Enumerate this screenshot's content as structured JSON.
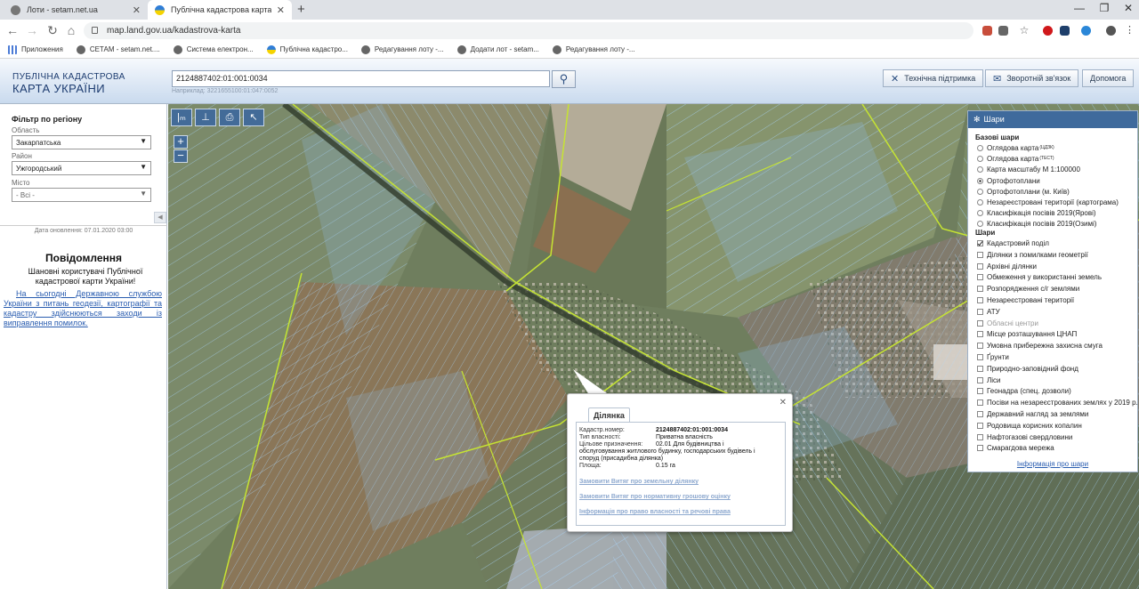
{
  "browser": {
    "tabs": [
      {
        "title": "Лоти - setam.net.ua",
        "icon": "globe-icon"
      },
      {
        "title": "Публічна кадастрова карта Укр",
        "icon": "ua-flag-icon"
      }
    ],
    "url": "map.land.gov.ua/kadastrova-karta",
    "bookmarks": [
      {
        "label": "Приложения",
        "icon": "apps-grid-icon"
      },
      {
        "label": "СЕТАМ - setam.net....",
        "icon": "globe-icon"
      },
      {
        "label": "Система електрон...",
        "icon": "globe-icon"
      },
      {
        "label": "Публічна кадастро...",
        "icon": "ua-flag-icon"
      },
      {
        "label": "Редагування лоту -...",
        "icon": "globe-icon"
      },
      {
        "label": "Додати лот - setam...",
        "icon": "globe-icon"
      },
      {
        "label": "Редагування лоту -...",
        "icon": "globe-icon"
      }
    ]
  },
  "header": {
    "logo_line1": "ПУБЛІЧНА КАДАСТРОВА",
    "logo_line2": "КАРТА УКРАЇНИ",
    "search_value": "2124887402:01:001:0034",
    "search_example": "Наприклад: 3221655100:01:047:0052",
    "buttons": {
      "support": "Технічна підтримка",
      "feedback": "Зворотній зв'язок",
      "help": "Допомога"
    }
  },
  "filter": {
    "title": "Фільтр по регіону",
    "oblast_label": "Область",
    "oblast_value": "Закарпатська",
    "raion_label": "Район",
    "raion_value": "Ужгородський",
    "city_label": "Місто",
    "city_value": "- Всі -"
  },
  "update_date": "Дата оновлення: 07.01.2020 03:00",
  "message": {
    "title": "Повідомлення",
    "greeting": "Шановні користувачі Публічної кадастрової карти України!",
    "body": "На сьогодні Державною службою України з питань геодезії, картографії та кадастру здійснюються заходи із виправлення помилок."
  },
  "popup": {
    "tab_label": "Ділянка",
    "rows": [
      {
        "label": "Кадастр.номер:",
        "value": "2124887402:01:001:0034"
      },
      {
        "label": "Тип власності:",
        "value": "Приватна власність"
      },
      {
        "label": "Цільове призначення:",
        "value": "02.01 Для будівництва і"
      },
      {
        "label": "",
        "value": "обслуговування житлового будинку, господарських будівель і"
      },
      {
        "label": "",
        "value": "споруд (присадибна ділянка)"
      },
      {
        "label": "Площа:",
        "value": "0.15 га"
      }
    ],
    "links": [
      "Замовити Витяг про земельну ділянку",
      "Замовити Витяг про нормативну грошову оцінку",
      "Інформація про право власності та речові права"
    ]
  },
  "layers": {
    "title": "Шари",
    "base_title": "Базові шари",
    "base": [
      {
        "label": "Оглядова карта",
        "sup": "(ЦДЗК)",
        "checked": false
      },
      {
        "label": "Оглядова карта",
        "sup": "(ТЕСТ)",
        "checked": false
      },
      {
        "label": "Карта масштабу М 1:100000",
        "sup": "",
        "checked": false
      },
      {
        "label": "Ортофотоплани",
        "sup": "",
        "checked": true
      },
      {
        "label": "Ортофотоплани (м. Київ)",
        "sup": "",
        "checked": false
      },
      {
        "label": "Незареєстровані території (картограма)",
        "sup": "",
        "checked": false
      },
      {
        "label": "Класифікація посівів 2019(Ярові)",
        "sup": "",
        "checked": false
      },
      {
        "label": "Класифікація посівів 2019(Озимі)",
        "sup": "",
        "checked": false
      }
    ],
    "overlay_title": "Шари",
    "overlays": [
      {
        "label": "Кадастровий поділ",
        "checked": true,
        "disabled": false
      },
      {
        "label": "Ділянки з помилками геометрії",
        "checked": false,
        "disabled": false
      },
      {
        "label": "Архівні ділянки",
        "checked": false,
        "disabled": false
      },
      {
        "label": "Обмеження у використанні земель",
        "checked": false,
        "disabled": false
      },
      {
        "label": "Розпорядження с/г землями",
        "checked": false,
        "disabled": false
      },
      {
        "label": "Незареєстровані території",
        "checked": false,
        "disabled": false
      },
      {
        "label": "АТУ",
        "checked": false,
        "disabled": false
      },
      {
        "label": "Обласні центри",
        "checked": false,
        "disabled": true
      },
      {
        "label": "Місце розташування ЦНАП",
        "checked": false,
        "disabled": false
      },
      {
        "label": "Умовна прибережна захисна смуга",
        "checked": false,
        "disabled": false
      },
      {
        "label": "Ґрунти",
        "checked": false,
        "disabled": false
      },
      {
        "label": "Природно-заповідний фонд",
        "checked": false,
        "disabled": false
      },
      {
        "label": "Ліси",
        "checked": false,
        "disabled": false
      },
      {
        "label": "Геонадра (спец. дозволи)",
        "checked": false,
        "disabled": false
      },
      {
        "label": "Посіви на незареєстрованих землях у 2019 р.",
        "checked": false,
        "disabled": false
      },
      {
        "label": "Державний нагляд за землями",
        "checked": false,
        "disabled": false
      },
      {
        "label": "Родовища корисних копалин",
        "checked": false,
        "disabled": false
      },
      {
        "label": "Нафтогазові свердловини",
        "checked": false,
        "disabled": false
      },
      {
        "label": "Смарагдова мережа",
        "checked": false,
        "disabled": false
      }
    ],
    "info_link": "Інформація про шари"
  },
  "colors": {
    "header_text": "#1d3c70",
    "toolbar_blue": "#436b98",
    "parcel_line": "#a9d8ff",
    "boundary_line": "#c6e432",
    "link_blue": "#2a5db0"
  }
}
